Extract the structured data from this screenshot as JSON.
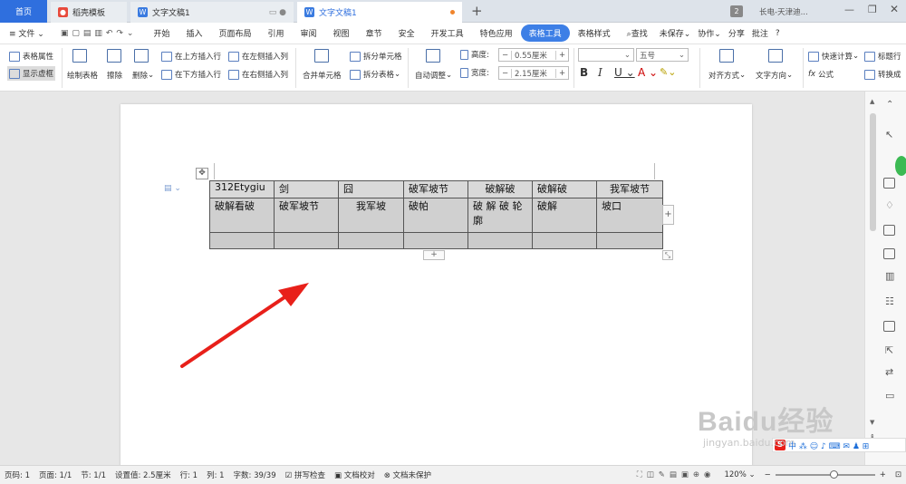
{
  "tabs": {
    "home": "首页",
    "tab1": "稻壳模板",
    "tab2": "文字文稿1",
    "tab3": "文字文稿1",
    "new_tab": "+",
    "badge": "2",
    "user": "长电-天津迪..."
  },
  "menu": {
    "file": "文件",
    "items": [
      "开始",
      "插入",
      "页面布局",
      "引用",
      "审阅",
      "视图",
      "章节",
      "安全",
      "开发工具",
      "特色应用",
      "表格工具",
      "表格样式"
    ],
    "search": "查找",
    "unsaved": "未保存",
    "collab": "协作",
    "share": "分享",
    "comment": "批注",
    "help": "?"
  },
  "ribbon": {
    "table_props": "表格属性",
    "show_grid": "显示虚框",
    "draw_table": "绘制表格",
    "erase": "擦除",
    "delete": "删除",
    "insert_above": "在上方插入行",
    "insert_below": "在下方插入行",
    "insert_left": "在左侧插入列",
    "insert_right": "在右侧插入列",
    "merge": "合并单元格",
    "split_cell": "拆分单元格",
    "split_table": "拆分表格",
    "autofit": "自动调整",
    "height_label": "高度:",
    "height_value": "0.55厘米",
    "width_label": "宽度:",
    "width_value": "2.15厘米",
    "font_size": "五号",
    "align": "对齐方式",
    "text_dir": "文字方向",
    "quick_calc": "快速计算",
    "formula": "公式",
    "title_row": "标题行",
    "convert": "转换成"
  },
  "table": {
    "rows": [
      [
        "312Etygiu",
        "剑",
        "囧",
        "破军坡节",
        "破解破",
        "破解破",
        "我军坡节"
      ],
      [
        "破解看破",
        "破军坡节",
        "我军坡",
        "破帕",
        "破 解 破 轮 廓",
        "破解",
        "坡口"
      ],
      [
        "",
        "",
        "",
        "",
        "",
        "",
        ""
      ]
    ]
  },
  "status": {
    "page_num": "页码: 1",
    "pages": "页面: 1/1",
    "section": "节: 1/1",
    "setting": "设置值: 2.5厘米",
    "row": "行: 1",
    "col": "列: 1",
    "words": "字数: 39/39",
    "spell": "拼写检查",
    "proof": "文档校对",
    "protect": "文档未保护",
    "zoom": "120%"
  },
  "watermark": {
    "brand": "Baidu经验",
    "url": "jingyan.baidu.com"
  },
  "colors": {
    "accent": "#2f6fde",
    "arrow": "#e8201a"
  }
}
